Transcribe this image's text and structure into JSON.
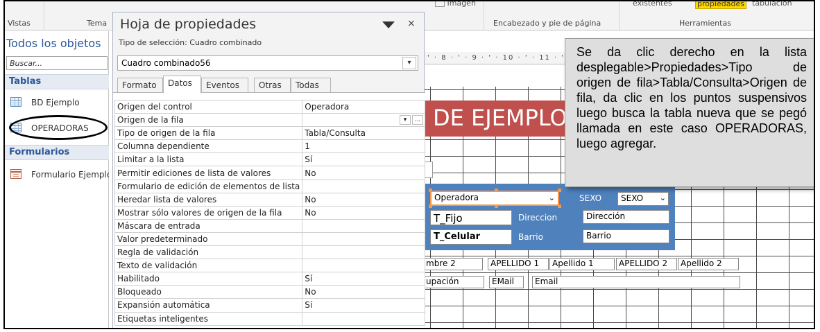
{
  "ribbon": {
    "top_left_label": "Vistas",
    "tema_label": "Tema",
    "imagen_label": "Imagen",
    "existentes_label": "existentes",
    "propiedades_label": "propiedades",
    "tabulacion_label": "tabulación",
    "header_footer_label": "Encabezado y pie de página",
    "tools_label": "Herramientas"
  },
  "nav_pane": {
    "title": "Todos los objetos",
    "search_placeholder": "Buscar...",
    "section_tables": "Tablas",
    "section_forms": "Formularios",
    "tables": [
      {
        "label": "BD Ejemplo",
        "icon": "table-icon"
      },
      {
        "label": "OPERADORAS",
        "icon": "table-icon"
      }
    ],
    "forms": [
      {
        "label": "Formulario Ejemplo",
        "icon": "form-icon"
      }
    ]
  },
  "property_sheet": {
    "title": "Hoja de propiedades",
    "selection_type": "Tipo de selección: Cuadro combinado",
    "selected_object": "Cuadro combinado56",
    "close_glyph": "×",
    "tabs": [
      "Formato",
      "Datos",
      "Eventos",
      "Otras",
      "Todas"
    ],
    "active_tab": "Datos",
    "properties": [
      {
        "name": "Origen del control",
        "value": "Operadora"
      },
      {
        "name": "Origen de la fila",
        "value": ""
      },
      {
        "name": "Tipo de origen de la fila",
        "value": "Tabla/Consulta"
      },
      {
        "name": "Columna dependiente",
        "value": "1"
      },
      {
        "name": "Limitar a la lista",
        "value": "Sí"
      },
      {
        "name": "Permitir ediciones de lista de valores",
        "value": "No"
      },
      {
        "name": "Formulario de edición de elementos de lista",
        "value": ""
      },
      {
        "name": "Heredar lista de valores",
        "value": "No"
      },
      {
        "name": "Mostrar sólo valores de origen de la fila",
        "value": "No"
      },
      {
        "name": "Máscara de entrada",
        "value": ""
      },
      {
        "name": "Valor predeterminado",
        "value": ""
      },
      {
        "name": "Regla de validación",
        "value": ""
      },
      {
        "name": "Texto de validación",
        "value": ""
      },
      {
        "name": "Habilitado",
        "value": "Sí"
      },
      {
        "name": "Bloqueado",
        "value": "No"
      },
      {
        "name": "Expansión automática",
        "value": "Sí"
      },
      {
        "name": "Etiquetas inteligentes",
        "value": ""
      }
    ],
    "dropdown_glyph": "▾",
    "builder_glyph": "..."
  },
  "designer": {
    "ruler_text": "' · 8 · ' · 9 · ' · 10 · ' · 11 · '",
    "form_title": "DE EJEMPLO",
    "combo_value": "Operadora",
    "sexo_label": "SEXO",
    "sexo_value": "SEXO",
    "t_fijo": "T_Fijo",
    "t_celular": "T_Celular",
    "direccion_label": "Direccion",
    "direccion_value": "Dirección",
    "barrio_label": "Barrio",
    "barrio_value": "Barrio",
    "nombre2": "mbre 2",
    "apellido1_label": "APELLIDO 1",
    "apellido1_value": "Apellido 1",
    "apellido2_label": "APELLIDO 2",
    "apellido2_value": "Apellido 2",
    "ocupacion": "upación",
    "email_label": "EMail",
    "email_value": "Email"
  },
  "note": {
    "text": "Se da clic derecho en la lista desplegable>Propiedades>Tipo de origen de fila>Tabla/Consulta>Origen de fila, da clic en los puntos suspensivos luego busca la tabla nueva que se pegó llamada en este caso OPERADORAS, luego agregar."
  },
  "colors": {
    "title_band": "#c0504d",
    "group_box": "#4f81bd",
    "selection_handle": "#f79646",
    "highlight": "#ffd800"
  }
}
